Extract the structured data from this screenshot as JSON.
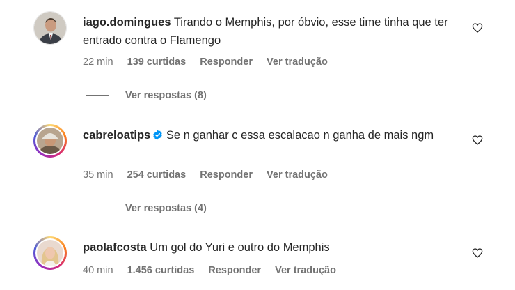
{
  "comments": [
    {
      "username": "iago.domingues",
      "text": "Tirando o Memphis, por óbvio, esse time tinha que ter entrado contra o Flamengo",
      "time": "22 min",
      "likes": "139 curtidas",
      "reply_label": "Responder",
      "translate_label": "Ver tradução",
      "view_replies": "Ver respostas (8)",
      "verified": false,
      "avatar_icon": "profile-photo-man-suit"
    },
    {
      "username": "cabreloatips",
      "text": "Se n ganhar c essa escalacao n ganha de mais ngm",
      "time": "35 min",
      "likes": "254 curtidas",
      "reply_label": "Responder",
      "translate_label": "Ver tradução",
      "view_replies": "Ver respostas (4)",
      "verified": true,
      "avatar_icon": "profile-photo-man-cap"
    },
    {
      "username": "paolafcosta",
      "text": "Um gol do Yuri e outro do Memphis",
      "time": "40 min",
      "likes": "1.456 curtidas",
      "reply_label": "Responder",
      "translate_label": "Ver tradução",
      "verified": false,
      "avatar_icon": "profile-photo-woman-blonde"
    }
  ],
  "icons": {
    "like": "heart-outline-icon",
    "verified": "verified-badge-icon"
  },
  "colors": {
    "verified": "#0095f6",
    "secondary_text": "#737373",
    "primary_text": "#262626"
  }
}
